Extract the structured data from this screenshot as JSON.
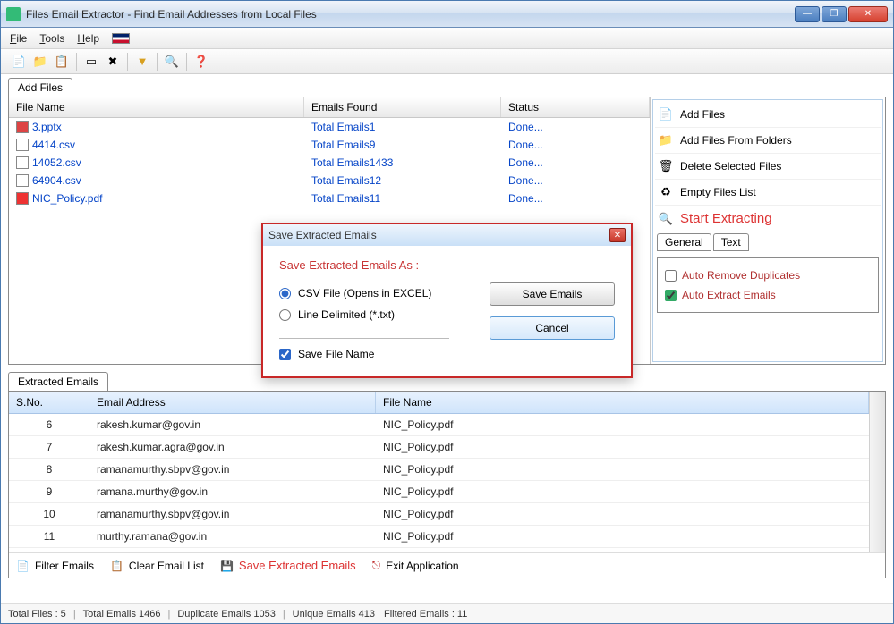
{
  "window": {
    "title": "Files Email Extractor -   Find Email Addresses from Local Files"
  },
  "menu": {
    "file": "File",
    "tools": "Tools",
    "help": "Help"
  },
  "tabs": {
    "add_files": "Add Files",
    "extracted_emails": "Extracted Emails"
  },
  "files_cols": {
    "name": "File Name",
    "emails": "Emails Found",
    "status": "Status"
  },
  "files": [
    {
      "name": "3.pptx",
      "emails": "Total Emails1",
      "status": "Done...",
      "type": "pptx"
    },
    {
      "name": "4414.csv",
      "emails": "Total Emails9",
      "status": "Done...",
      "type": "csv"
    },
    {
      "name": "14052.csv",
      "emails": "Total Emails1433",
      "status": "Done...",
      "type": "csv"
    },
    {
      "name": "64904.csv",
      "emails": "Total Emails12",
      "status": "Done...",
      "type": "csv"
    },
    {
      "name": "NIC_Policy.pdf",
      "emails": "Total Emails11",
      "status": "Done...",
      "type": "pdf"
    }
  ],
  "side": {
    "add_files": "Add Files",
    "add_from_folders": "Add Files From Folders",
    "delete_selected": "Delete Selected Files",
    "empty_list": "Empty Files List",
    "start": "Start Extracting"
  },
  "opt_tabs": {
    "general": "General",
    "text": "Text"
  },
  "opts": {
    "auto_remove_dupes": "Auto Remove Duplicates",
    "auto_extract": "Auto Extract Emails"
  },
  "emails_cols": {
    "sno": "S.No.",
    "addr": "Email Address",
    "file": "File Name"
  },
  "emails": [
    {
      "sno": "6",
      "addr": "rakesh.kumar@gov.in",
      "file": "NIC_Policy.pdf"
    },
    {
      "sno": "7",
      "addr": "rakesh.kumar.agra@gov.in",
      "file": "NIC_Policy.pdf"
    },
    {
      "sno": "8",
      "addr": "ramanamurthy.sbpv@gov.in",
      "file": "NIC_Policy.pdf"
    },
    {
      "sno": "9",
      "addr": "ramana.murthy@gov.in",
      "file": "NIC_Policy.pdf"
    },
    {
      "sno": "10",
      "addr": "ramanamurthy.sbpv@gov.in",
      "file": "NIC_Policy.pdf"
    },
    {
      "sno": "11",
      "addr": "murthy.ramana@gov.in",
      "file": "NIC_Policy.pdf"
    }
  ],
  "bottom": {
    "filter": "Filter Emails",
    "clear": "Clear Email List",
    "save": "Save Extracted Emails",
    "exit": "Exit Application"
  },
  "status": {
    "total_files": "Total Files :  5",
    "total_emails": "Total Emails  1466",
    "dup_emails": "Duplicate Emails  1053",
    "unique_emails": "Unique Emails  413",
    "filtered": "Filtered Emails :  11"
  },
  "dialog": {
    "title": "Save Extracted Emails",
    "heading": "Save Extracted Emails As :",
    "csv_opt": "CSV File (Opens in EXCEL)",
    "txt_opt": "Line Delimited (*.txt)",
    "save_filename": "Save File Name",
    "save_btn": "Save Emails",
    "cancel_btn": "Cancel"
  }
}
